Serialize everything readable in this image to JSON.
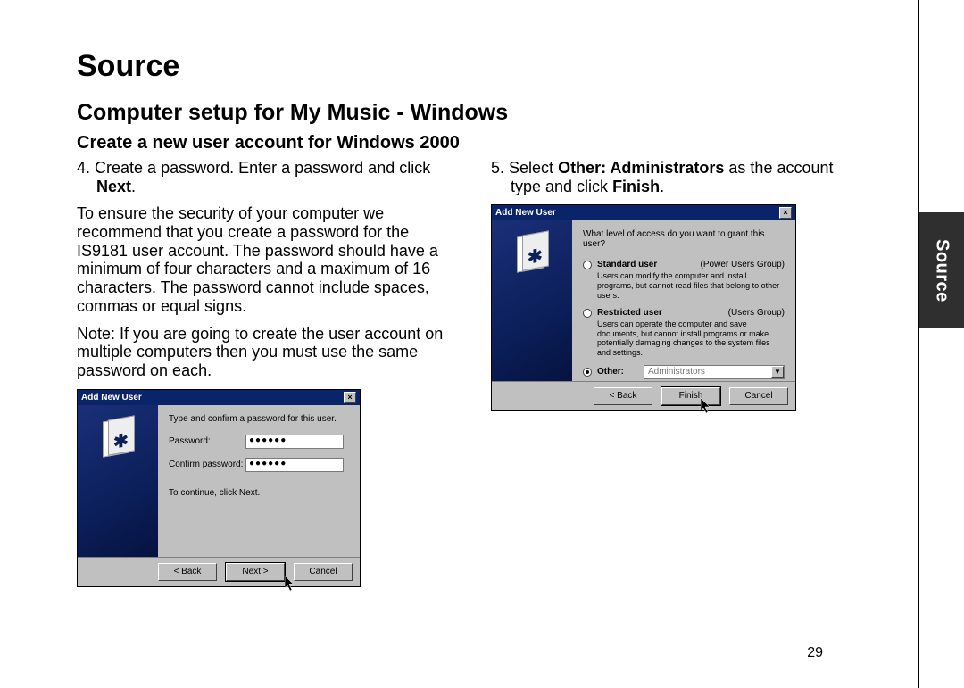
{
  "sideTab": "Source",
  "title": "Source",
  "subtitle": "Computer setup for My Music - Windows",
  "section": "Create a new user account for Windows 2000",
  "left": {
    "step4_num": "4.",
    "step4_a": "Create a password. Enter a password and click ",
    "step4_bold": "Next",
    "step4_end": ".",
    "para1": "To ensure the security of your computer we recommend that you create a password for the IS9181 user account. The password should have a minimum of four characters and a maximum of 16 characters. The password cannot include spaces, commas or equal signs.",
    "para2": "Note: If you are going to create the user account on multiple computers then you must use the same password on each."
  },
  "right": {
    "step5_num": "5.",
    "step5_a": "Select ",
    "step5_bold": "Other: Administrators",
    "step5_b": " as the account type and click ",
    "step5_bold2": "Finish",
    "step5_end": "."
  },
  "dlg1": {
    "title": "Add New User",
    "close": "×",
    "prompt": "Type and confirm a password for this user.",
    "pwdLabel": "Password:",
    "pwdValue": "●●●●●●",
    "confirmLabel": "Confirm password:",
    "confirmValue": "●●●●●●",
    "continueNote": "To continue, click Next.",
    "back": "< Back",
    "next": "Next >",
    "cancel": "Cancel"
  },
  "dlg2": {
    "title": "Add New User",
    "close": "×",
    "prompt": "What level of access do you want to grant this user?",
    "opt1": "Standard user",
    "opt1group": "(Power Users Group)",
    "opt1desc": "Users can modify the computer and install programs, but cannot read files that belong to other users.",
    "opt2": "Restricted user",
    "opt2group": "(Users Group)",
    "opt2desc": "Users can operate the computer and save documents, but cannot install programs or make potentially damaging changes to the system files and settings.",
    "opt3": "Other:",
    "dropdown": "Administrators",
    "back": "< Back",
    "finish": "Finish",
    "cancel": "Cancel"
  },
  "pageNum": "29"
}
